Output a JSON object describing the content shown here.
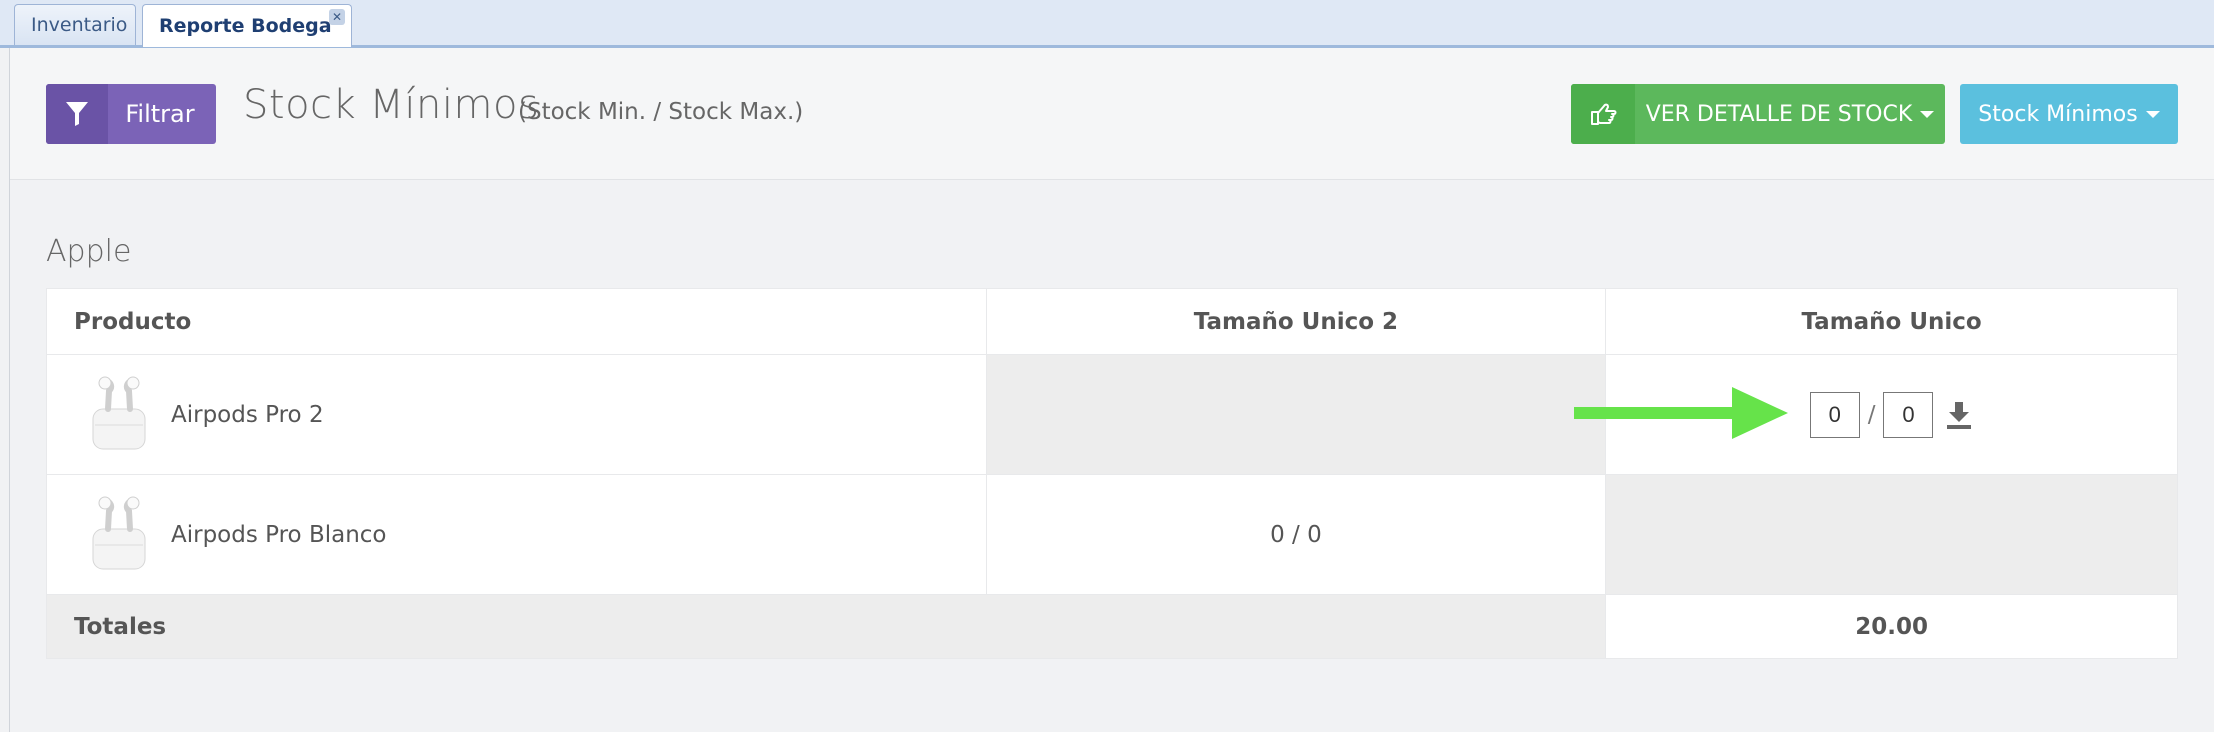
{
  "tabs": [
    {
      "label": "Inventario",
      "active": false
    },
    {
      "label": "Reporte Bodega",
      "active": true,
      "closable": true
    }
  ],
  "header": {
    "filter_label": "Filtrar",
    "title": "Stock Mínimos",
    "subtitle": "(Stock Min. / Stock Max.)",
    "detail_button_label": "VER DETALLE DE STOCK",
    "stock_button_label": "Stock Mínimos"
  },
  "group": {
    "title": "Apple",
    "columns": [
      "Producto",
      "Tamaño Unico 2",
      "Tamaño Unico"
    ],
    "rows": [
      {
        "name": "Airpods Pro 2",
        "tamano_unico_2": "",
        "tamano_unico": {
          "min": "0",
          "max": "0"
        }
      },
      {
        "name": "Airpods Pro Blanco",
        "tamano_unico_2": "0 / 0",
        "tamano_unico": null
      }
    ],
    "totals": {
      "label": "Totales",
      "value": "20.00"
    }
  },
  "annotation": {
    "arrow_color": "#66e34a"
  },
  "colors": {
    "filter_button": "#7b63b7",
    "detail_button": "#5cb85c",
    "stock_button": "#5bc0de"
  }
}
